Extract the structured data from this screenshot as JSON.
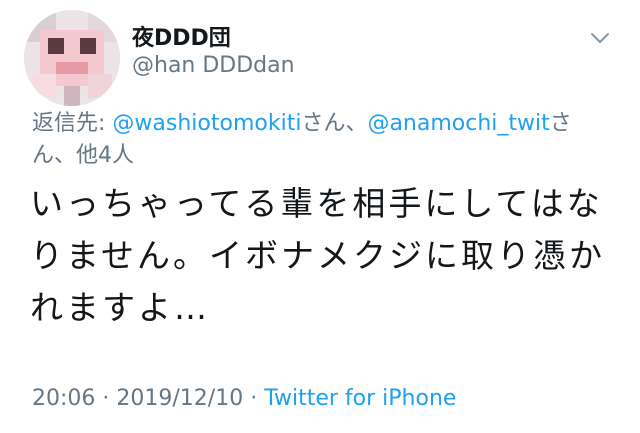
{
  "user": {
    "display_name": "夜DDD団",
    "handle": "@han DDDdan"
  },
  "reply": {
    "prefix": "返信先: ",
    "mention1": "@washiotomokiti",
    "suffix1": "さん、",
    "mention2": "@anamochi_twit",
    "suffix2": "さん、",
    "others": "他4人"
  },
  "tweet": {
    "line1": "いっちゃってる輩を相手にしてはな",
    "line2": "りません。イボナメクジに取り憑か",
    "line3": "れますよ…"
  },
  "meta": {
    "time": "20:06",
    "sep1": " · ",
    "date": "2019/12/10",
    "sep2": " · ",
    "source": "Twitter for iPhone"
  },
  "colors": {
    "link": "#1da1f2",
    "muted": "#657786",
    "text": "#14171a"
  },
  "icons": {
    "caret": "chevron-down-icon"
  }
}
